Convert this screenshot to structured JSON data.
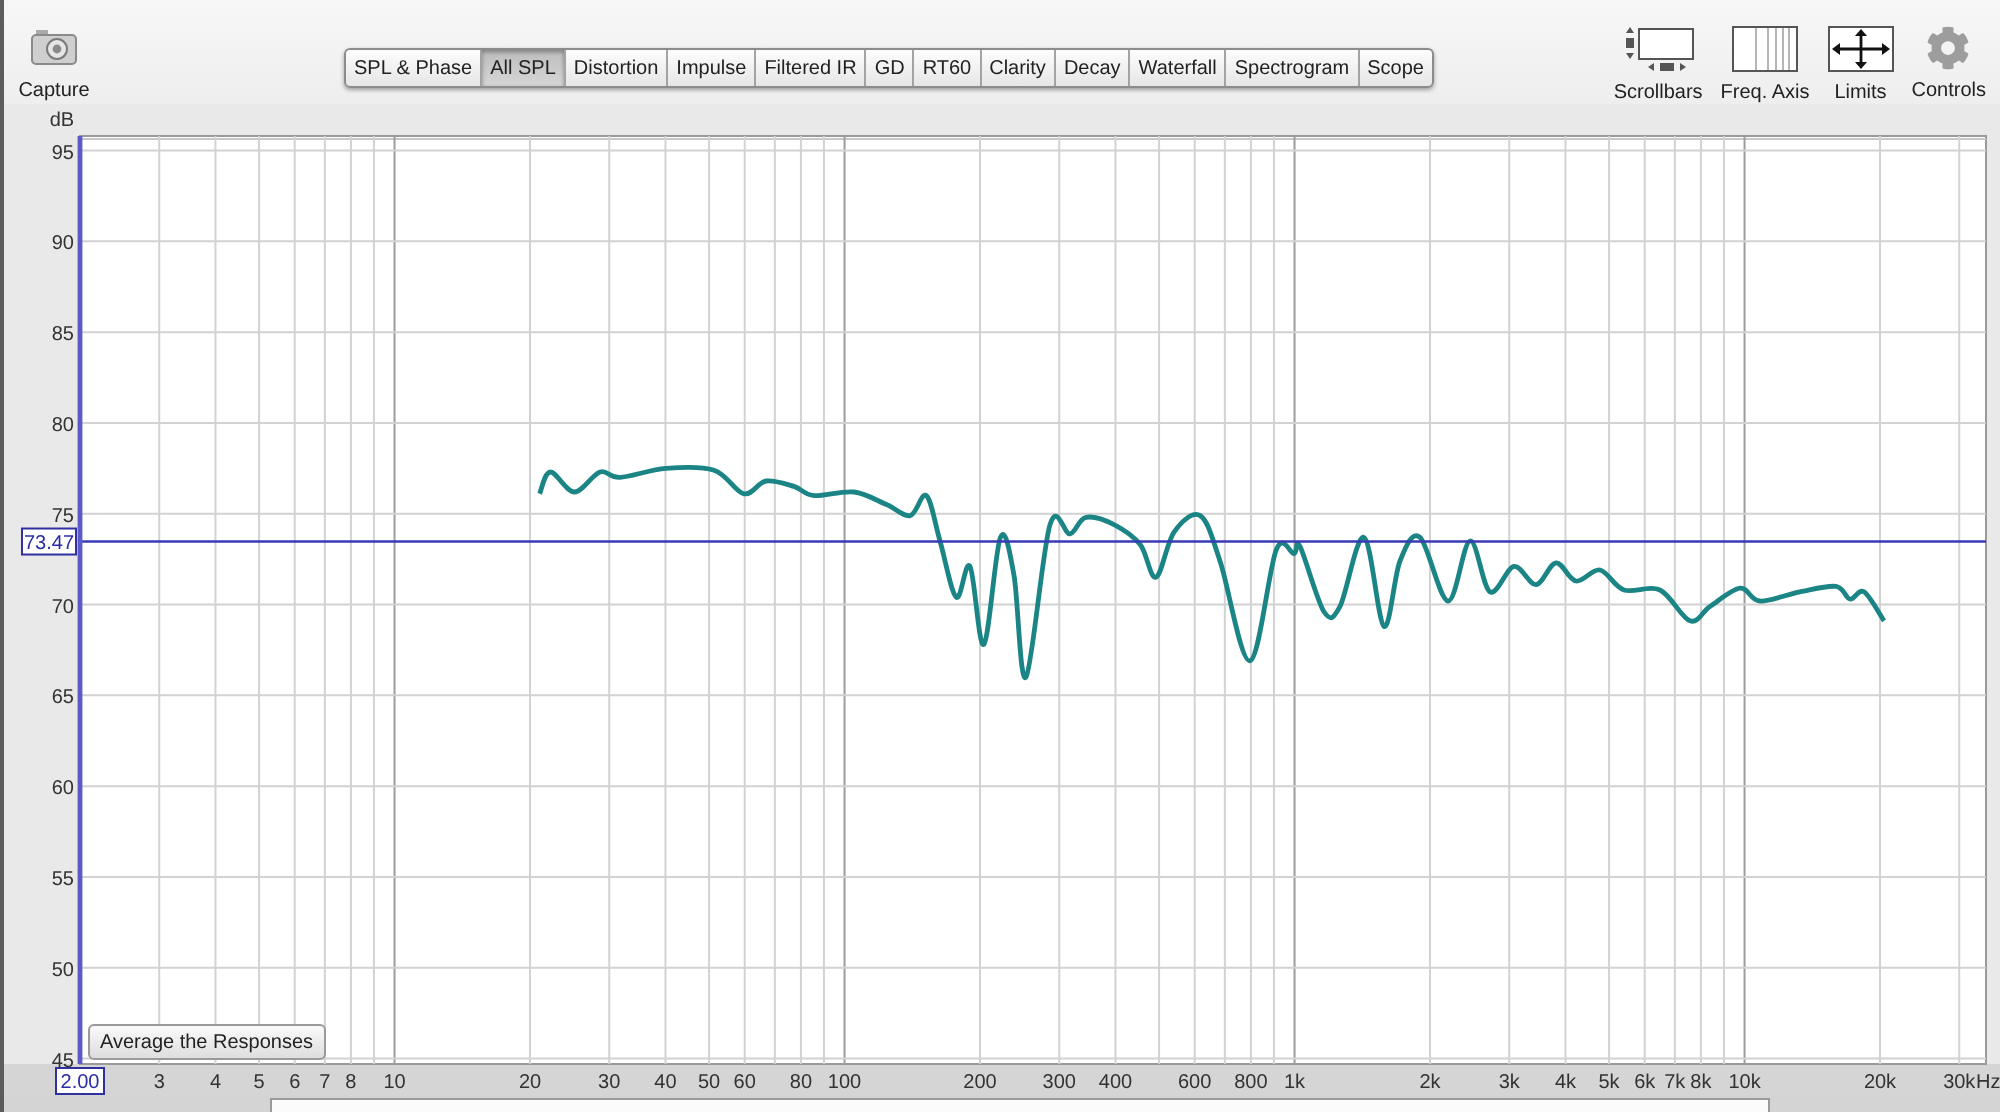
{
  "toolbar": {
    "capture": {
      "label": "Capture"
    },
    "tabs": [
      {
        "label": "SPL & Phase",
        "selected": false
      },
      {
        "label": "All SPL",
        "selected": true
      },
      {
        "label": "Distortion",
        "selected": false
      },
      {
        "label": "Impulse",
        "selected": false
      },
      {
        "label": "Filtered IR",
        "selected": false
      },
      {
        "label": "GD",
        "selected": false
      },
      {
        "label": "RT60",
        "selected": false
      },
      {
        "label": "Clarity",
        "selected": false
      },
      {
        "label": "Decay",
        "selected": false
      },
      {
        "label": "Waterfall",
        "selected": false
      },
      {
        "label": "Spectrogram",
        "selected": false
      },
      {
        "label": "Scope",
        "selected": false
      }
    ],
    "tools": [
      {
        "kind": "scrollbars",
        "label": "Scrollbars"
      },
      {
        "kind": "freq-axis",
        "label": "Freq. Axis"
      },
      {
        "kind": "limits",
        "label": "Limits"
      },
      {
        "kind": "controls",
        "label": "Controls"
      }
    ]
  },
  "graph": {
    "average_button": "Average the Responses",
    "cursor": {
      "frequency": "2.00"
    },
    "chart_data": {
      "type": "line",
      "log": "x",
      "grid": true,
      "xlabel": "Hz",
      "ylabel": "dB",
      "xlim": [
        2,
        34400
      ],
      "ylim": [
        44.7,
        95.8
      ],
      "yticks": [
        45,
        50,
        55,
        60,
        65,
        70,
        75,
        80,
        85,
        90,
        95
      ],
      "xticks": [
        {
          "value": 3,
          "label": "3"
        },
        {
          "value": 4,
          "label": "4"
        },
        {
          "value": 5,
          "label": "5"
        },
        {
          "value": 6,
          "label": "6"
        },
        {
          "value": 7,
          "label": "7"
        },
        {
          "value": 8,
          "label": "8"
        },
        {
          "value": 10,
          "label": "10"
        },
        {
          "value": 20,
          "label": "20"
        },
        {
          "value": 30,
          "label": "30"
        },
        {
          "value": 40,
          "label": "40"
        },
        {
          "value": 50,
          "label": "50"
        },
        {
          "value": 60,
          "label": "60"
        },
        {
          "value": 80,
          "label": "80"
        },
        {
          "value": 100,
          "label": "100"
        },
        {
          "value": 200,
          "label": "200"
        },
        {
          "value": 300,
          "label": "300"
        },
        {
          "value": 400,
          "label": "400"
        },
        {
          "value": 600,
          "label": "600"
        },
        {
          "value": 800,
          "label": "800"
        },
        {
          "value": 1000,
          "label": "1k"
        },
        {
          "value": 2000,
          "label": "2k"
        },
        {
          "value": 3000,
          "label": "3k"
        },
        {
          "value": 4000,
          "label": "4k"
        },
        {
          "value": 5000,
          "label": "5k"
        },
        {
          "value": 6000,
          "label": "6k"
        },
        {
          "value": 7000,
          "label": "7k"
        },
        {
          "value": 8000,
          "label": "8k"
        },
        {
          "value": 10000,
          "label": "10k"
        },
        {
          "value": 20000,
          "label": "20k"
        },
        {
          "value": 30000,
          "label": "30k"
        }
      ],
      "ref_lines": [
        {
          "axis": "y",
          "value": 73.47,
          "label": "73.47"
        }
      ],
      "x": [
        21,
        22.2,
        25.1,
        28.6,
        31.7,
        40.1,
        51.3,
        59.8,
        66.9,
        77.2,
        85.5,
        105,
        124,
        140,
        152,
        163,
        177,
        190,
        204,
        222,
        238,
        253,
        286,
        317,
        344,
        397,
        454,
        492,
        540,
        617,
        683,
        796,
        910,
        997,
        1028,
        1163,
        1262,
        1427,
        1581,
        1715,
        1900,
        2193,
        2454,
        2719,
        3074,
        3440,
        3811,
        4221,
        4774,
        5398,
        6488,
        7566,
        8382,
        9772,
        10824,
        13282,
        15970,
        17154,
        18426,
        20414
      ],
      "series": [
        {
          "color": "#1b8585",
          "values": [
            76.1,
            77.3,
            76.2,
            77.3,
            77.0,
            77.5,
            77.4,
            76.1,
            76.8,
            76.5,
            76.0,
            76.2,
            75.5,
            74.9,
            76.0,
            73.5,
            70.4,
            72.1,
            67.8,
            73.7,
            71.6,
            66.0,
            74.4,
            73.9,
            74.8,
            74.4,
            73.3,
            71.5,
            74.0,
            74.9,
            72.4,
            66.9,
            73.0,
            72.8,
            73.2,
            69.6,
            69.9,
            73.7,
            68.8,
            72.4,
            73.7,
            70.2,
            73.5,
            70.7,
            72.1,
            71.1,
            72.3,
            71.3,
            71.9,
            70.8,
            70.8,
            69.1,
            69.9,
            70.9,
            70.2,
            70.7,
            71.0,
            70.3,
            70.7,
            69.1
          ]
        }
      ]
    }
  }
}
